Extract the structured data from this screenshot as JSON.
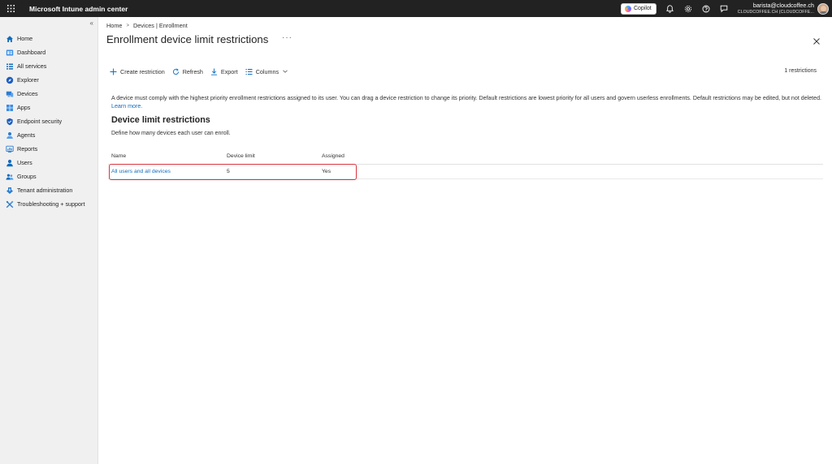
{
  "header": {
    "app_title": "Microsoft Intune admin center",
    "copilot_label": "Copilot",
    "account_email": "barista@cloudcoffee.ch",
    "account_tenant": "CLOUDCOFFEE.CH (CLOUDCOFFE...",
    "icons": [
      "waffle-icon",
      "bell-icon",
      "gear-icon",
      "help-icon",
      "feedback-icon"
    ]
  },
  "sidebar": {
    "collapse_glyph": "«",
    "items": [
      {
        "label": "Home",
        "icon": "home-icon"
      },
      {
        "label": "Dashboard",
        "icon": "dashboard-icon"
      },
      {
        "label": "All services",
        "icon": "all-services-icon"
      },
      {
        "label": "Explorer",
        "icon": "explorer-icon"
      },
      {
        "label": "Devices",
        "icon": "devices-icon"
      },
      {
        "label": "Apps",
        "icon": "apps-icon"
      },
      {
        "label": "Endpoint security",
        "icon": "shield-icon"
      },
      {
        "label": "Agents",
        "icon": "agents-icon"
      },
      {
        "label": "Reports",
        "icon": "reports-icon"
      },
      {
        "label": "Users",
        "icon": "user-icon"
      },
      {
        "label": "Groups",
        "icon": "groups-icon"
      },
      {
        "label": "Tenant administration",
        "icon": "tenant-icon"
      },
      {
        "label": "Troubleshooting + support",
        "icon": "wrench-icon"
      }
    ]
  },
  "breadcrumb": {
    "items": [
      "Home",
      "Devices | Enrollment"
    ]
  },
  "page": {
    "title": "Enrollment device limit restrictions",
    "more": "···"
  },
  "toolbar": {
    "create": "Create restriction",
    "refresh": "Refresh",
    "export": "Export",
    "columns": "Columns",
    "count": "1 restrictions"
  },
  "content": {
    "description": "A device must comply with the highest priority enrollment restrictions assigned to its user. You can drag a device restriction to change its priority. Default restrictions are lowest priority for all users and govern userless enrollments. Default restrictions may be edited, but not deleted.",
    "learn_more": "Learn more.",
    "section_title": "Device limit restrictions",
    "section_sub": "Define how many devices each user can enroll."
  },
  "table": {
    "columns": [
      "Name",
      "Device limit",
      "Assigned"
    ],
    "rows": [
      {
        "name": "All users and all devices",
        "limit": "5",
        "assigned": "Yes"
      }
    ]
  },
  "colors": {
    "topbar": "#222222",
    "sidebar": "#f0f0f0",
    "link": "#0f6cbd",
    "highlight": "#d9363e",
    "accent": "#0f6cbd"
  }
}
